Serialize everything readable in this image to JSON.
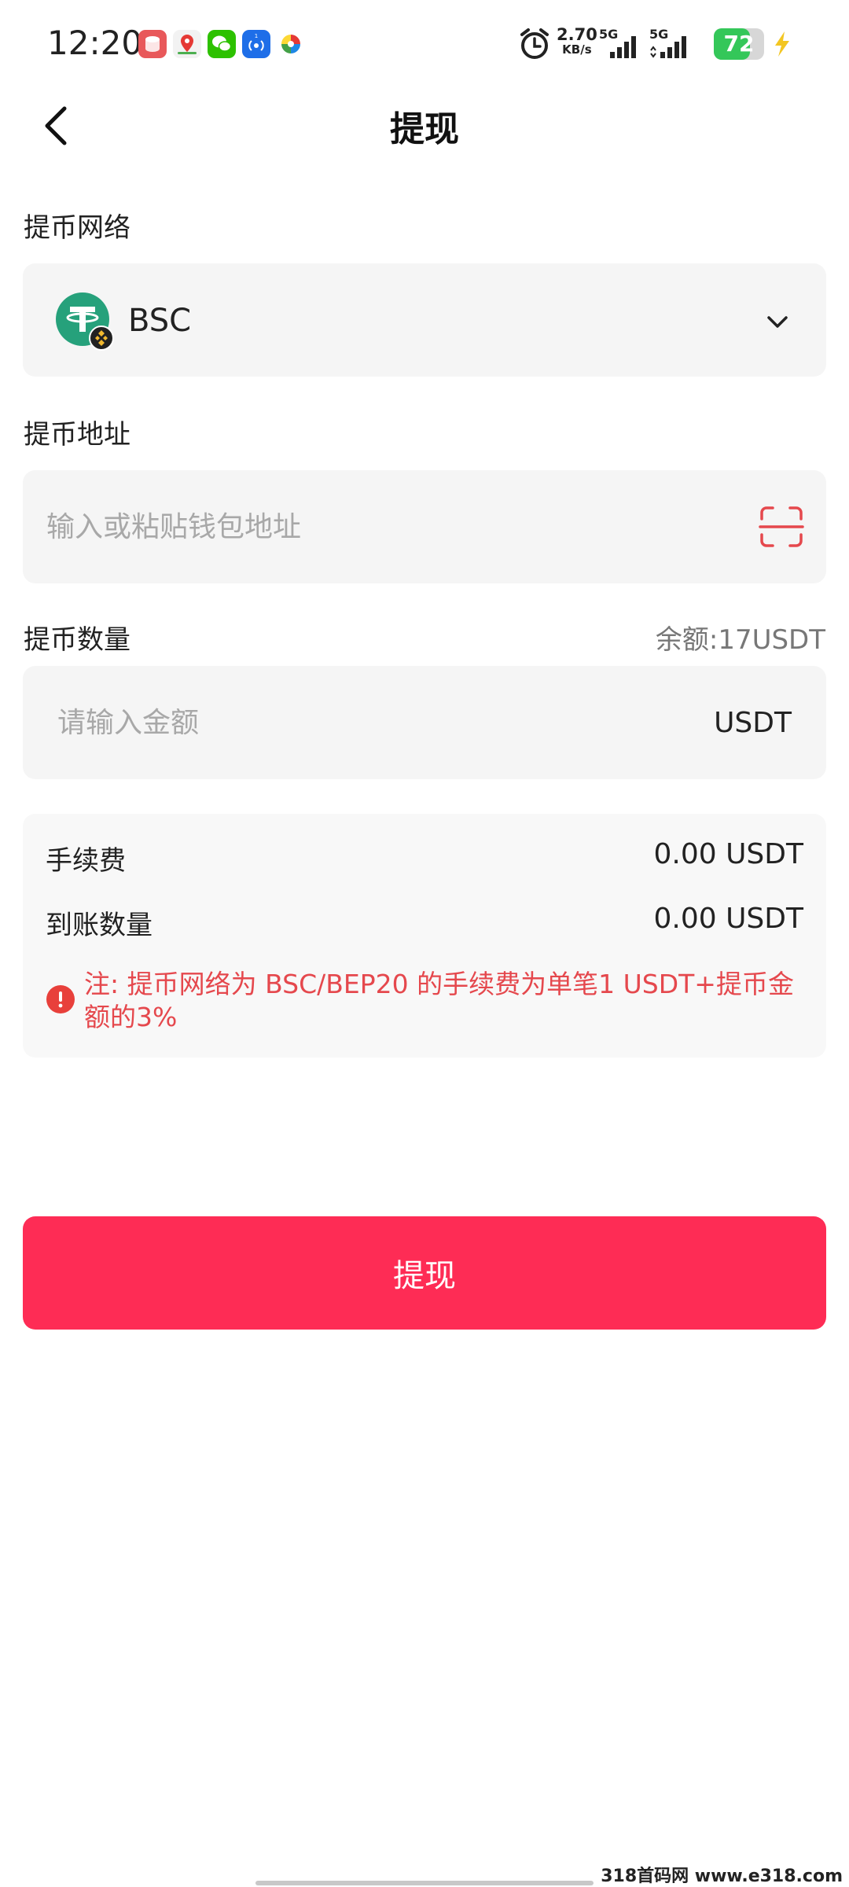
{
  "status_bar": {
    "time": "12:20",
    "net_speed_value": "2.70",
    "net_speed_unit": "KB/s",
    "sim1_label": "5G",
    "sim2_label": "5G",
    "battery_level": "72",
    "icons": [
      "app-red-icon",
      "maps-icon",
      "wechat-icon",
      "cast-icon",
      "pinwheel-icon",
      "alarm-icon",
      "signal-icon",
      "signal-icon",
      "battery-icon",
      "charging-icon"
    ]
  },
  "header": {
    "title": "提现"
  },
  "network": {
    "label": "提币网络",
    "value": "BSC"
  },
  "address": {
    "label": "提币地址",
    "placeholder": "输入或粘贴钱包地址",
    "value": ""
  },
  "amount": {
    "label": "提币数量",
    "balance": "余额:17USDT",
    "placeholder": "请输入金额",
    "value": "",
    "unit": "USDT"
  },
  "fees": {
    "fee_label": "手续费",
    "fee_value": "0.00 USDT",
    "receive_label": "到账数量",
    "receive_value": "0.00 USDT",
    "note": "注: 提币网络为 BSC/BEP20 的手续费为单笔1 USDT+提币金额的3%"
  },
  "submit": {
    "label": "提现"
  },
  "watermark": "318首码网 www.e318.com",
  "colors": {
    "accent": "#fe2c55",
    "warning": "#e5484d",
    "tether": "#26a17b",
    "bnb": "#f3ba2f"
  }
}
